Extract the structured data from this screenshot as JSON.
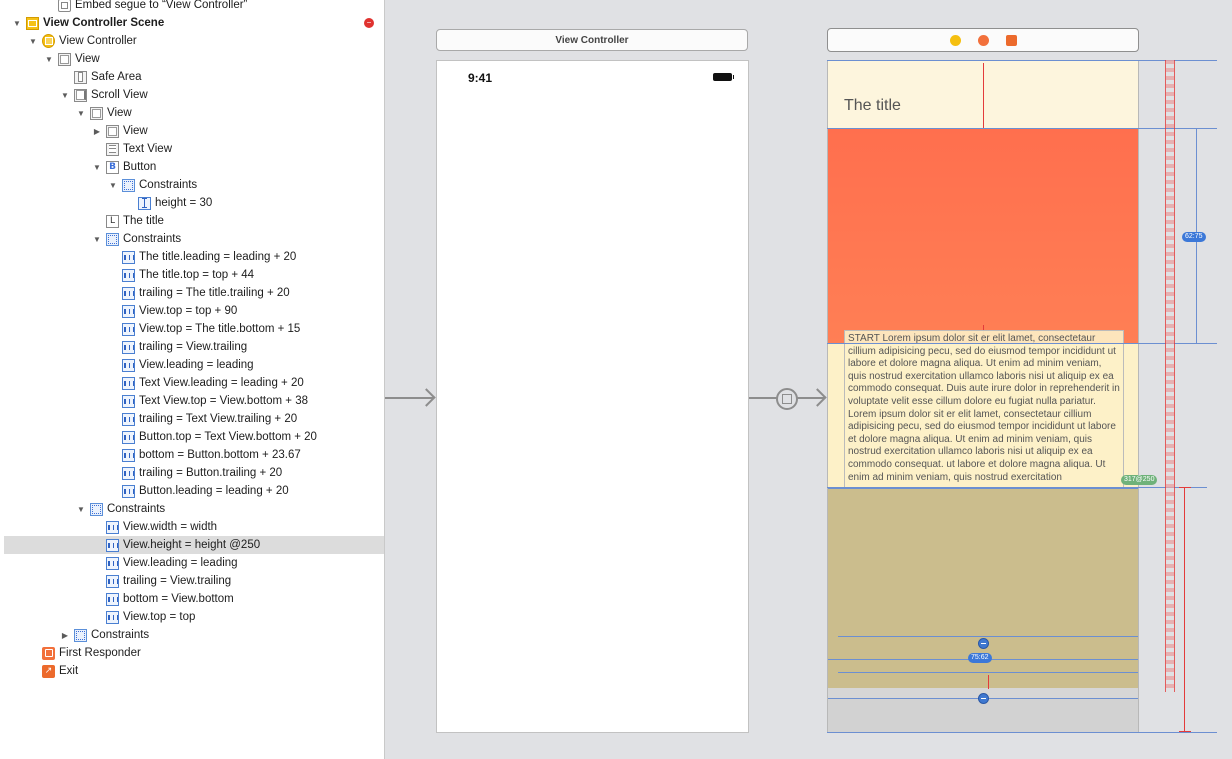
{
  "outline": {
    "rows": [
      {
        "label": "Embed segue to “View Controller”",
        "indent": 2,
        "disclosure": "none",
        "icon": "segue-icon"
      },
      {
        "label": "View Controller Scene",
        "indent": 0,
        "disclosure": "open",
        "icon": "scene-icon",
        "bold": true,
        "badge": true
      },
      {
        "label": "View Controller",
        "indent": 1,
        "disclosure": "open",
        "icon": "view-controller-icon"
      },
      {
        "label": "View",
        "indent": 2,
        "disclosure": "open",
        "icon": "view-icon"
      },
      {
        "label": "Safe Area",
        "indent": 3,
        "disclosure": "none",
        "icon": "safe-area-icon"
      },
      {
        "label": "Scroll View",
        "indent": 3,
        "disclosure": "open",
        "icon": "scroll-view-icon"
      },
      {
        "label": "View",
        "indent": 4,
        "disclosure": "open",
        "icon": "view-icon"
      },
      {
        "label": "View",
        "indent": 5,
        "disclosure": "closed",
        "icon": "view-icon"
      },
      {
        "label": "Text View",
        "indent": 5,
        "disclosure": "none",
        "icon": "text-view-icon"
      },
      {
        "label": "Button",
        "indent": 5,
        "disclosure": "open",
        "icon": "button-icon"
      },
      {
        "label": "Constraints",
        "indent": 6,
        "disclosure": "open",
        "icon": "constraints-icon"
      },
      {
        "label": "height = 30",
        "indent": 7,
        "disclosure": "none",
        "icon": "height-constraint-icon"
      },
      {
        "label": "The title",
        "indent": 5,
        "disclosure": "none",
        "icon": "label-icon"
      },
      {
        "label": "Constraints",
        "indent": 5,
        "disclosure": "open",
        "icon": "constraints-icon"
      },
      {
        "label": "The title.leading = leading + 20",
        "indent": 6,
        "disclosure": "none",
        "icon": "constraint-icon"
      },
      {
        "label": "The title.top = top + 44",
        "indent": 6,
        "disclosure": "none",
        "icon": "constraint-icon"
      },
      {
        "label": "trailing = The title.trailing + 20",
        "indent": 6,
        "disclosure": "none",
        "icon": "constraint-icon"
      },
      {
        "label": "View.top = top + 90",
        "indent": 6,
        "disclosure": "none",
        "icon": "constraint-icon"
      },
      {
        "label": "View.top = The title.bottom + 15",
        "indent": 6,
        "disclosure": "none",
        "icon": "constraint-icon"
      },
      {
        "label": "trailing = View.trailing",
        "indent": 6,
        "disclosure": "none",
        "icon": "constraint-icon"
      },
      {
        "label": "View.leading = leading",
        "indent": 6,
        "disclosure": "none",
        "icon": "constraint-icon"
      },
      {
        "label": "Text View.leading = leading + 20",
        "indent": 6,
        "disclosure": "none",
        "icon": "constraint-icon"
      },
      {
        "label": "Text View.top = View.bottom + 38",
        "indent": 6,
        "disclosure": "none",
        "icon": "constraint-icon"
      },
      {
        "label": "trailing = Text View.trailing + 20",
        "indent": 6,
        "disclosure": "none",
        "icon": "constraint-icon"
      },
      {
        "label": "Button.top = Text View.bottom + 20",
        "indent": 6,
        "disclosure": "none",
        "icon": "constraint-icon"
      },
      {
        "label": "bottom = Button.bottom + 23.67",
        "indent": 6,
        "disclosure": "none",
        "icon": "constraint-icon"
      },
      {
        "label": "trailing = Button.trailing + 20",
        "indent": 6,
        "disclosure": "none",
        "icon": "constraint-icon"
      },
      {
        "label": "Button.leading = leading + 20",
        "indent": 6,
        "disclosure": "none",
        "icon": "constraint-icon"
      },
      {
        "label": "Constraints",
        "indent": 4,
        "disclosure": "open",
        "icon": "constraints-icon"
      },
      {
        "label": "View.width = width",
        "indent": 5,
        "disclosure": "none",
        "icon": "constraint-icon"
      },
      {
        "label": "View.height = height @250",
        "indent": 5,
        "disclosure": "none",
        "icon": "constraint-icon",
        "selected": true
      },
      {
        "label": "View.leading = leading",
        "indent": 5,
        "disclosure": "none",
        "icon": "constraint-icon"
      },
      {
        "label": "trailing = View.trailing",
        "indent": 5,
        "disclosure": "none",
        "icon": "constraint-icon"
      },
      {
        "label": "bottom = View.bottom",
        "indent": 5,
        "disclosure": "none",
        "icon": "constraint-icon"
      },
      {
        "label": "View.top = top",
        "indent": 5,
        "disclosure": "none",
        "icon": "constraint-icon"
      },
      {
        "label": "Constraints",
        "indent": 3,
        "disclosure": "closed",
        "icon": "constraints-icon"
      },
      {
        "label": "First Responder",
        "indent": 1,
        "disclosure": "none",
        "icon": "first-responder-icon"
      },
      {
        "label": "Exit",
        "indent": 1,
        "disclosure": "none",
        "icon": "exit-icon"
      }
    ]
  },
  "canvas": {
    "destination_scene_title": "View Controller",
    "phone_time": "9:41",
    "title_label": "The title",
    "text_view_content": "START Lorem ipsum dolor sit er elit lamet, consectetaur cillium adipisicing pecu, sed do eiusmod tempor incididunt ut labore et dolore magna aliqua. Ut enim ad minim veniam, quis nostrud exercitation ullamco laboris nisi ut aliquip ex ea commodo consequat. Duis aute irure dolor in reprehenderit in voluptate velit esse cillum dolore eu fugiat nulla pariatur. Lorem ipsum dolor sit er elit lamet, consectetaur cillium adipisicing pecu, sed do eiusmod tempor incididunt ut labore et dolore magna aliqua. Ut enim ad minim veniam, quis nostrud exercitation ullamco laboris nisi ut aliquip ex ea commodo consequat. ut labore et dolore magna aliqua. Ut enim ad minim veniam, quis nostrud exercitation",
    "height_badge": "62:75",
    "priority_badge": "317@250",
    "bottom_badge": "75:62"
  },
  "colors": {
    "title_region": "#fdf5dd",
    "orange_region": "#ff7452",
    "text_region": "#fdf1c8",
    "tan_region": "#cbbd8d",
    "constraint_blue": "#3c78d8",
    "constraint_red": "#e33b3b"
  }
}
